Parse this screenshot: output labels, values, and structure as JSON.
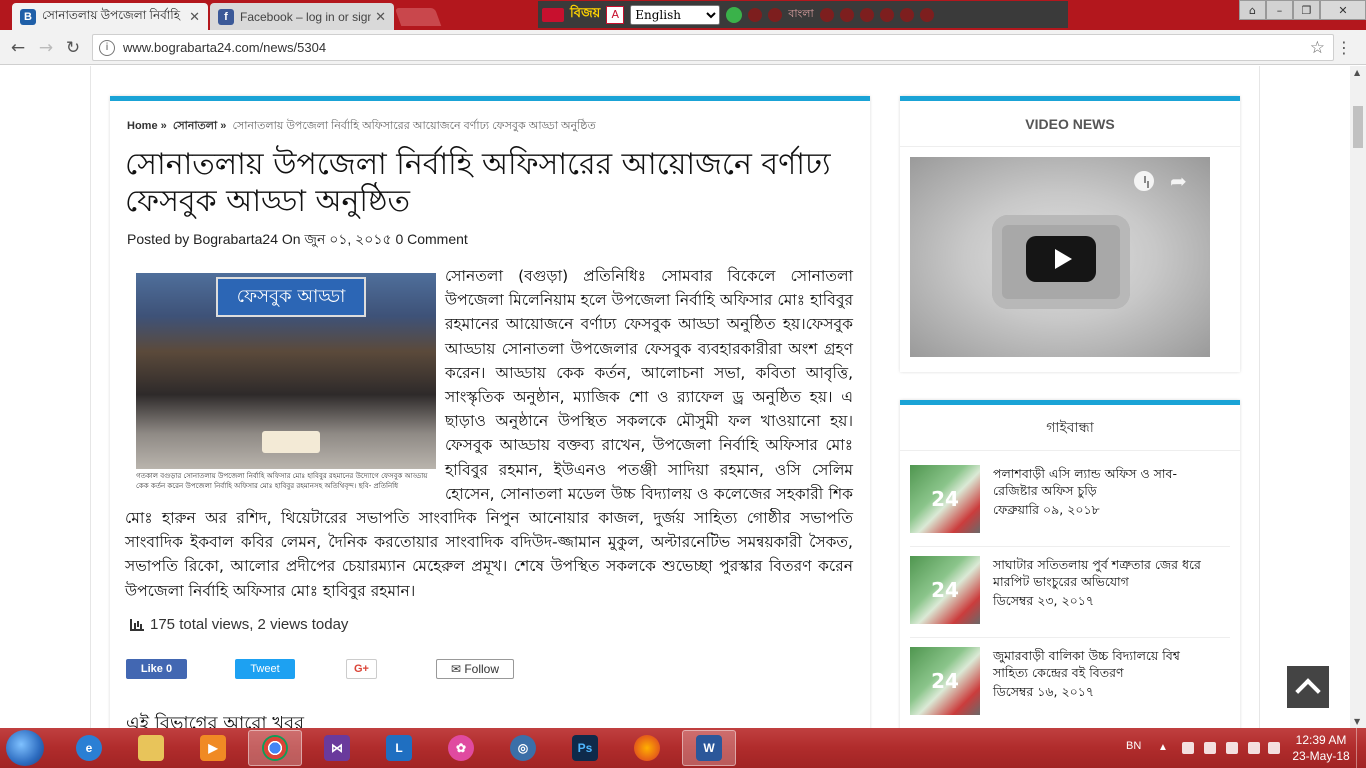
{
  "browser": {
    "tabs": [
      {
        "title": "সোনাতলায় উপজেলা নির্বাহি",
        "favicon": "B"
      },
      {
        "title": "Facebook – log in or sign",
        "favicon": "f"
      }
    ],
    "url": "www.bograbarta24.com/news/5304"
  },
  "ime": {
    "brand": "বিজয়",
    "language": "English",
    "bengali_label": "বাংলা"
  },
  "article": {
    "breadcrumb": {
      "home": "Home »",
      "category": "সোনাতলা »",
      "current": "সোনাতলায় উপজেলা নির্বাহি অফিসারের আয়োজনে বর্ণাঢ্য ফেসবুক আড্ডা অনুষ্ঠিত"
    },
    "headline": "সোনাতলায় উপজেলা নির্বাহি অফিসারের আয়োজনে বর্ণাঢ্য ফেসবুক আড্ডা অনুষ্ঠিত",
    "meta": "Posted by Bograbarta24  On জুন ০১, ২০১৫  0 Comment",
    "photo_banner": "ফেসবুক আড্ডা",
    "photo_caption": "গতকাল বগুড়ার সোনাতলায় উপজেলা নির্বাহি অফিসার মোঃ হাবিবুর রহমানের উদ্যোগে ফেসবুক আড্ডায় কেক কর্তন করেন উপজেলা নির্বাহি অফিসার মোঃ হাবিবুর রহমানসহ অতিথিবৃন্দ। ছবি- প্রতিনিধি",
    "body": "সোনতলা (বগুড়া) প্রতিনিধিঃ সোমবার বিকেলে সোনাতলা উপজেলা মিলেনিয়াম হলে উপজেলা নির্বাহি অফিসার মোঃ হাবিবুর রহমানের আয়োজনে বর্ণাঢ্য ফেসবুক আড্ডা অনুষ্ঠিত হয়।ফেসবুক আড্ডায় সোনাতলা উপজেলার ফেসবুক ব্যবহারকারীরা অংশ গ্রহণ করেন। আড্ডায় কেক কর্তন, আলোচনা সভা, কবিতা আবৃত্তি, সাংস্কৃতিক অনুষ্ঠান, ম্যাজিক শো ও র‌্যাফেল ড্র অনুষ্ঠিত হয়। এ ছাড়াও অনুষ্ঠানে উপস্থিত সকলকে মৌসুমী ফল খাওয়ানো হয়।ফেসবুক আড্ডায় বক্তব্য রাখেন, উপজেলা নির্বাহি অফিসার মোঃ হাবিবুর রহমান, ইউএনও পতঞ্জী সাদিয়া রহমান, ওসি সেলিম হোসেন, সোনাতলা মডেল উচ্চ বিদ্যালয় ও কলেজের সহকারী শিক মোঃ হারুন অর রশিদ, থিয়েটারের সভাপতি সাংবাদিক নিপুন আনোয়ার কাজল, দুর্জয় সাহিত্য গোষ্ঠীর সভাপতি সাংবাদিক ইকবাল কবির লেমন, দৈনিক করতোয়ার সাংবাদিক বদিউদ-জ্জামান মুকুল, অল্টারনেটিভ সমন্বয়কারী সৈকত, সভাপতি রিকো, আলোর প্রদীপের চেয়ারম্যান মেহেরুল প্রমূখ। শেষে উপস্থিত সকলকে শুভেচ্ছা পুরস্কার বিতরণ করেন উপজেলা নির্বাহি অফিসার মোঃ হাবিবুর রহমান।",
    "views": "175 total views, 2 views today",
    "share": {
      "like": "Like 0",
      "tweet": "Tweet",
      "gplus": "G+",
      "follow": "Follow"
    },
    "more_news": "এই বিভাগের আরো খবর"
  },
  "sidebar": {
    "video_title": "VIDEO NEWS",
    "news_title": "গাইবান্ধা",
    "items": [
      {
        "title": "পলাশবাড়ী এসি ল্যান্ড অফিস ও সাব-রেজিষ্টার অফিস চুড়ি",
        "date": "ফেব্রুয়ারি ০৯, ২০১৮"
      },
      {
        "title": "সাঘাটার সতিতলায় পুর্ব শত্রুতার জের ধরে মারপিট ভাংচুরের অভিযোগ",
        "date": "ডিসেম্বর ২৩, ২০১৭"
      },
      {
        "title": "জুমারবাড়ী বালিকা উচ্চ বিদ্যালয়ে বিশ্ব সাহিত্য কেন্দ্রের বই বিতরণ",
        "date": "ডিসেম্বর ১৬, ২০১৭"
      }
    ]
  },
  "taskbar": {
    "language": "BN",
    "time": "12:39 AM",
    "date": "23-May-18"
  },
  "colors": {
    "accent": "#1aa3d6",
    "taskbar": "#b02c2c"
  }
}
